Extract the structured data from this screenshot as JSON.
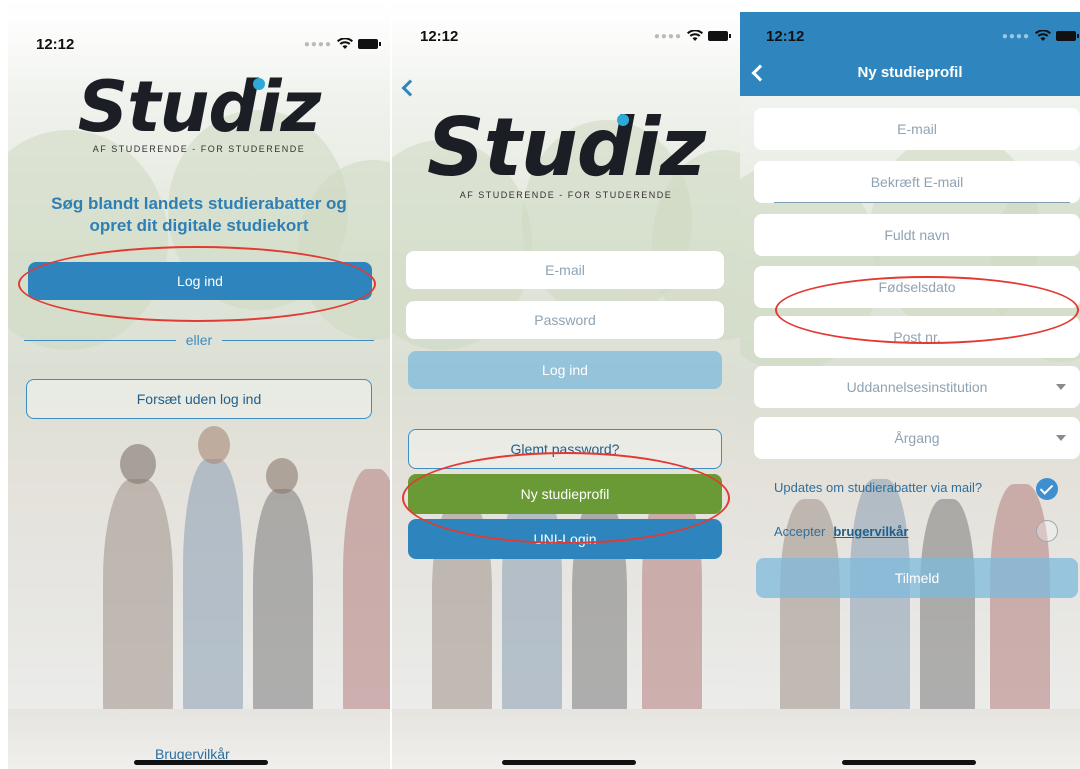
{
  "screen1": {
    "status_time": "12:12",
    "logo_word": "Studiz",
    "logo_sub": "AF STUDERENDE - FOR STUDERENDE",
    "tagline_line1": "Søg blandt landets studierabatter og",
    "tagline_line2": "opret dit digitale studiekort",
    "login_label": "Log ind",
    "divider_text": "eller",
    "continue_label": "Forsæt uden log ind",
    "terms_link": "Brugervilkår"
  },
  "screen2": {
    "status_time": "12:12",
    "logo_word": "Studiz",
    "logo_sub": "AF STUDERENDE - FOR STUDERENDE",
    "email_placeholder": "E-mail",
    "password_placeholder": "Password",
    "login_label": "Log ind",
    "forgot_label": "Glemt password?",
    "new_profile_label": "Ny studieprofil",
    "uni_login_label": "UNI-Login"
  },
  "screen3": {
    "status_time": "12:12",
    "title": "Ny studieprofil",
    "fields": {
      "email": "E-mail",
      "confirm_email": "Bekræft E-mail",
      "full_name": "Fuldt navn",
      "birthdate": "Fødselsdato",
      "postal_code": "Post nr.",
      "institution": "Uddannelsesinstitution",
      "year": "Årgang"
    },
    "updates_label": "Updates om studierabatter via mail?",
    "updates_checked": true,
    "accept_prefix": "Accepter",
    "accept_link": "brugervilkår",
    "accept_checked": false,
    "submit_label": "Tilmeld"
  },
  "colors": {
    "primary_blue": "#2e85bd",
    "green": "#6a9a35",
    "annotation_red": "#e23a32"
  }
}
